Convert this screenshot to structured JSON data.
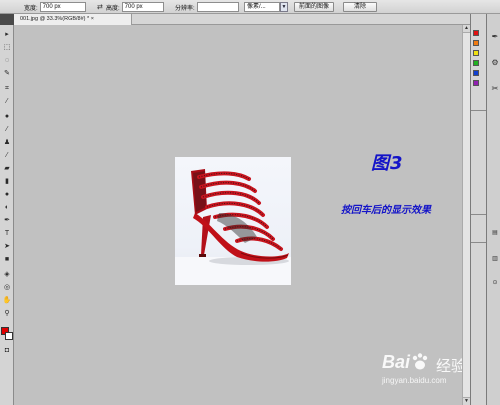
{
  "options_bar": {
    "width_label": "宽度:",
    "width_value": "700 px",
    "height_label": "高度:",
    "height_value": "700 px",
    "resolution_label": "分辨率:",
    "resolution_value": "",
    "unit_value": "像素/...",
    "front_image_button": "前面的图像",
    "clear_button": "清除"
  },
  "document_tab": {
    "title": "001.jpg @ 33.3%(RGB/8#) * ",
    "close": "×"
  },
  "canvas": {
    "annotation_title": "图3",
    "annotation_subtitle": "按回车后的显示效果"
  },
  "watermark": {
    "brand": "Bai",
    "jingyan": "经验",
    "url": "jingyan.baidu.com"
  },
  "colors": {
    "foreground": "#e00000",
    "background": "#ffffff",
    "annotation": "#1414c8"
  }
}
